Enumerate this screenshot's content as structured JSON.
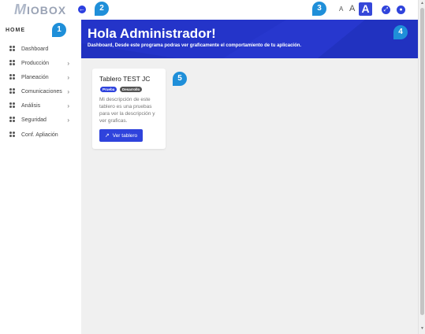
{
  "logo": {
    "text": "IOBOX",
    "initial": "M"
  },
  "topbar": {
    "back_icon": "←",
    "font_small": "A",
    "font_medium": "A",
    "font_large": "A",
    "expand_icon": "⤢",
    "user_icon": "●"
  },
  "sidebar": {
    "home": "HOME",
    "items": [
      {
        "label": "Dashboard",
        "has_children": false
      },
      {
        "label": "Producción",
        "has_children": true
      },
      {
        "label": "Planeación",
        "has_children": true
      },
      {
        "label": "Comunicaciones",
        "has_children": true
      },
      {
        "label": "Análisis",
        "has_children": true
      },
      {
        "label": "Seguridad",
        "has_children": true
      },
      {
        "label": "Conf. Apliación",
        "has_children": false
      }
    ],
    "chevron": "›"
  },
  "banner": {
    "title": "Hola Administrador!",
    "subtitle": "Dashboard, Desde este programa podras ver graficamente el comportamiento de tu aplicación."
  },
  "card": {
    "title": "Tablero TEST JC",
    "tags": [
      "Prueba",
      "Desarrollo"
    ],
    "description": "Mi descripción de este tablero es una pruebas para ver la descripción y ver graficas.",
    "button_label": "Ver tablero",
    "button_icon": "↗"
  },
  "markers": [
    "1",
    "2",
    "3",
    "4",
    "5"
  ],
  "scrollbar": {
    "up": "▲",
    "down": "▼"
  },
  "colors": {
    "primary": "#2f43dc",
    "banner": "#2434c9",
    "marker": "#1f8fd9"
  }
}
